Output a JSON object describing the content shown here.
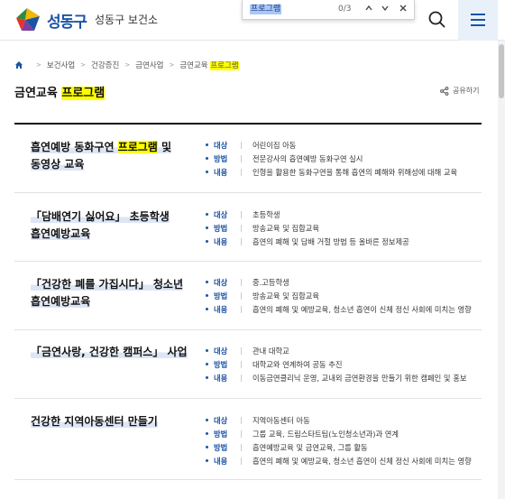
{
  "header": {
    "logo_text": "성동구",
    "subtitle": "성동구 보건소"
  },
  "findbar": {
    "query": "프로그램",
    "count": "0/3"
  },
  "breadcrumb": {
    "items": [
      "보건사업",
      "건강증진",
      "금연사업"
    ],
    "last_plain": "금연교육 ",
    "last_highlight": "프로그램"
  },
  "page": {
    "title_plain": "금연교육 ",
    "title_highlight": "프로그램",
    "share_label": "공유하기"
  },
  "labels": {
    "target": "대상",
    "method": "방법",
    "content": "내용"
  },
  "programs": [
    {
      "title_line1_pre": "흡연예방 동화구연 ",
      "title_line1_hl": "프로그램",
      "title_line1_post": " 및",
      "title_line2": "동영상 교육",
      "target": "어린이집 아동",
      "method": "전문강사의 흡연예방 동화구연 실시",
      "content": "인형을 활용한 동화구연을 통해 흡연의 폐해와 위해성에 대해 교육"
    },
    {
      "title_line1": "「담배연기 싫어요」 초등학생",
      "title_line2": "흡연예방교육",
      "target": "초등학생",
      "method": "방송교육 및 집합교육",
      "content": "흡연의 폐해 및 담배 거절 방법 등 올바른 정보제공"
    },
    {
      "title_line1": "「건강한 폐를 가집시다」 청소년",
      "title_line2": "흡연예방교육",
      "target": "중.고등학생",
      "method": "방송교육 및 집합교육",
      "content": "흡연의 폐해 및 예방교육, 청소년 흡연이 신체 정신 사회에 미치는 영향"
    },
    {
      "title_line1": "「금연사랑, 건강한 캠퍼스」 사업",
      "target": "관내 대학교",
      "method": "대학교와 연계하여 공동 추진",
      "content": "이동금연클리닉 운영, 교내외 금연환경을 만들기 위한 캠페인 및 홍보"
    },
    {
      "title_line1": "건강한 지역아동센터 만들기",
      "target": "지역아동센터 아동",
      "method": "그룹 교육, 드림스타트팀(노인청소년과)과 연계",
      "method2": "흡연예방교육 및 금연교육, 그룹 활동",
      "content": "흡연의 폐해 및 예방교육, 청소년 흡연이 신체 정신 사회에 미치는 영향"
    }
  ]
}
